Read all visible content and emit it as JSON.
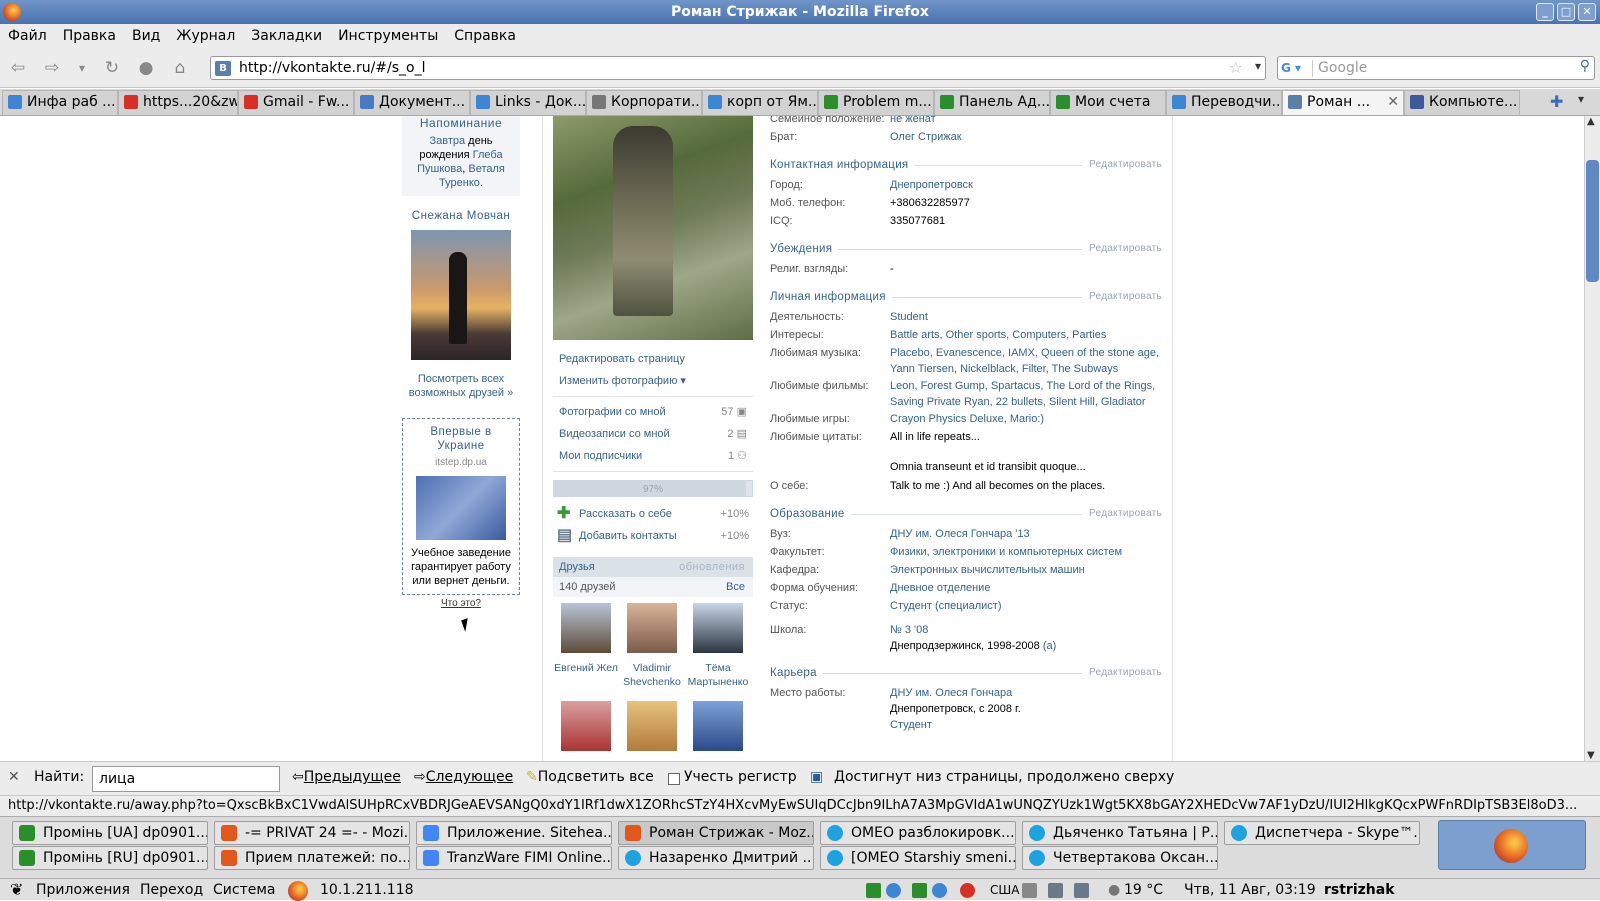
{
  "window": {
    "title": "Роман Стрижак - Mozilla Firefox"
  },
  "menu": [
    "Файл",
    "Правка",
    "Вид",
    "Журнал",
    "Закладки",
    "Инструменты",
    "Справка"
  ],
  "nav": {
    "url": "http://vkontakte.ru/#/s_o_l",
    "search_placeholder": "Google"
  },
  "tabs": [
    {
      "label": "Инфа раб ...",
      "color": "#3d86d6"
    },
    {
      "label": "https...20&zw",
      "color": "#d93025"
    },
    {
      "label": "Gmail - Fw...",
      "color": "#d93025"
    },
    {
      "label": "Документ...",
      "color": "#4a79c4"
    },
    {
      "label": "Links - Док...",
      "color": "#3d86d6"
    },
    {
      "label": "Корпорати...",
      "color": "#777777"
    },
    {
      "label": "корп от Ям...",
      "color": "#3d86d6"
    },
    {
      "label": "Problem m...",
      "color": "#2a8f2a"
    },
    {
      "label": "Панель Ад...",
      "color": "#2a8f2a"
    },
    {
      "label": "Мои счета",
      "color": "#2a8f2a"
    },
    {
      "label": "Переводчи...",
      "color": "#3d86d6"
    },
    {
      "label": "Роман ...",
      "color": "#5b7fa6",
      "active": true
    },
    {
      "label": "Компьюте...",
      "color": "#3a5a9a"
    }
  ],
  "left": {
    "reminder_title": "Напоминание",
    "reminder_pre": "Завтра",
    "reminder_mid": " день рождения ",
    "reminder_name1": "Глеба Пушкова",
    "reminder_comma": ", ",
    "reminder_name2": "Веталя Туренко",
    "reminder_end": ".",
    "friend_name": "Снежана Мовчан",
    "all_friends": "Посмотреть всех возможных друзей »",
    "ad_title": "Впервые в Украине",
    "ad_domain": "itstep.dp.ua",
    "ad_body": "Учебное заведение гарантирует работу или вернет деньги.",
    "what": "Что это?"
  },
  "mid": {
    "edit_page": "Редактировать страницу",
    "change_photo": "Изменить фотографию ▾",
    "photos_label": "Фотографии со мной",
    "photos_count": "57",
    "videos_label": "Видеозаписи со мной",
    "videos_count": "2",
    "subs_label": "Мои подписчики",
    "subs_count": "1",
    "progress": "97%",
    "progress_value": 97,
    "tell": "Рассказать о себе",
    "tell_pct": "+10%",
    "contacts": "Добавить контакты",
    "contacts_pct": "+10%",
    "friends_title": "Друзья",
    "friends_updates": "обновления",
    "friends_count": "140 друзей",
    "friends_all": "Все",
    "friends": [
      {
        "name": "Евгений Жел",
        "c1": "#b8c4d6",
        "c2": "#5d4b3a"
      },
      {
        "name": "Vladimir Shevchenko",
        "c1": "#d8b49a",
        "c2": "#7a5a48"
      },
      {
        "name": "Тёма Мартыненко",
        "c1": "#c9d6e8",
        "c2": "#2b3440"
      },
      {
        "name": "",
        "c1": "#d9a0a0",
        "c2": "#a33"
      },
      {
        "name": "",
        "c1": "#e7c37c",
        "c2": "#b07b3c"
      },
      {
        "name": "",
        "c1": "#7ea0d6",
        "c2": "#2a4a8a"
      }
    ]
  },
  "info": {
    "family_k": "Семейное положение:",
    "family_v": "не женат",
    "brother_k": "Брат:",
    "brother_v": "Олег Стрижак",
    "contact_h": "Контактная информация",
    "edit": "Редактировать",
    "city_k": "Город:",
    "city_v": "Днепропетровск",
    "phone_k": "Моб. телефон:",
    "phone_v": "+380632285977",
    "icq_k": "ICQ:",
    "icq_v": "335077681",
    "belief_h": "Убеждения",
    "relig_k": "Религ. взгляды:",
    "relig_v": "-",
    "personal_h": "Личная информация",
    "activity_k": "Деятельность:",
    "activity_v": "Student",
    "interests_k": "Интересы:",
    "interests_v": "Battle arts, Other sports, Computers, Parties",
    "music_k": "Любимая музыка:",
    "music_v": "Placebo, Evanescence, IAMX, Queen of the stone age, Yann Tiersen, Nickelblack, Filter, The Subways",
    "films_k": "Любимые фильмы:",
    "films_v": "Leon, Forest Gump, Spartacus, The Lord of the Rings, Saving Private Ryan, 22 bullets, Silent Hill, Gladiator",
    "games_k": "Любимые игры:",
    "games_v": "Crayon Physics Deluxe, Mario:)",
    "quotes_k": "Любимые цитаты:",
    "quotes_v1": "All in life repeats...",
    "quotes_v2": "Omnia transeunt et id transibit quoque...",
    "about_k": "О себе:",
    "about_v": "Talk to me :) And all becomes on the places.",
    "edu_h": "Образование",
    "uni_k": "Вуз:",
    "uni_v": "ДНУ им. Олеся Гончара '13",
    "fac_k": "Факультет:",
    "fac_v": "Физики, электроники и компьютерных систем",
    "dept_k": "Кафедра:",
    "dept_v": "Электронных вычислительных машин",
    "form_k": "Форма обучения:",
    "form_v": "Дневное отделение",
    "status_k": "Статус:",
    "status_v": "Студент (специалист)",
    "school_k": "Школа:",
    "school_v": "№ 3 '08",
    "school_v2": "Днепродзержинск, 1998-2008",
    "school_a": "(a)",
    "career_h": "Карьера",
    "work_k": "Место работы:",
    "work_v": "ДНУ им. Олеся Гончара",
    "work_v2": "Днепропетровск, с 2008 г.",
    "work_v3": "Студент"
  },
  "find": {
    "label": "Найти:",
    "value": "лица",
    "prev": "Предыдущее",
    "next": "Следующее",
    "highlight": "Подсветить все",
    "match_case": "Учесть регистр",
    "msg": "Достигнут низ страницы, продолжено сверху"
  },
  "status_url": "http://vkontakte.ru/away.php?to=QxscBkBxC1VwdAlSUHpRCxVBDRJGeAEVSANgQ0xdY1IRf1dwX1ZORhcSTzY4HXcvMyEwSUIqDCcJbn9ILhA7A3MpGVIdA1wUNQZYUzk1Wgt5KX8bGAY2XHEDcVw7AF1yDzU/IUI2HlkgKQcxPWFnRDIpTSB3El8oD3...",
  "taskbar": [
    {
      "label": "Промінь [UA] dp0901...",
      "color": "#2a8f2a"
    },
    {
      "label": "-= PRIVAT 24 =- - Mozi...",
      "color": "#e2571e"
    },
    {
      "label": "Приложение. Siteheа...",
      "color": "#4285f4"
    },
    {
      "label": "Роман Стрижак - Moz...",
      "color": "#e2571e",
      "active": true
    },
    {
      "label": "OMEO разблокировк...",
      "color": "#1fa3e0"
    },
    {
      "label": "Дьяченко Татьяна | Р...",
      "color": "#1fa3e0"
    },
    {
      "label": "Диспетчера - Skype™...",
      "color": "#1fa3e0"
    },
    {
      "label": "Промінь [RU] dp0901...",
      "color": "#2a8f2a"
    },
    {
      "label": "Прием платежей: по...",
      "color": "#e2571e"
    },
    {
      "label": "TranzWare FIMI Online...",
      "color": "#4285f4"
    },
    {
      "label": "Назаренко Дмитрий ...",
      "color": "#1fa3e0"
    },
    {
      "label": "[OMEO Starshiy smeni...",
      "color": "#1fa3e0"
    },
    {
      "label": "Четвертакова Оксан...",
      "color": "#1fa3e0"
    }
  ],
  "panel": {
    "apps": "Приложения",
    "go": "Переход",
    "system": "Система",
    "ip": "10.1.211.118",
    "layout": "США",
    "temp": "19 °C",
    "datetime": "Чтв, 11 Авг, 03:19",
    "user": "rstrizhak"
  }
}
